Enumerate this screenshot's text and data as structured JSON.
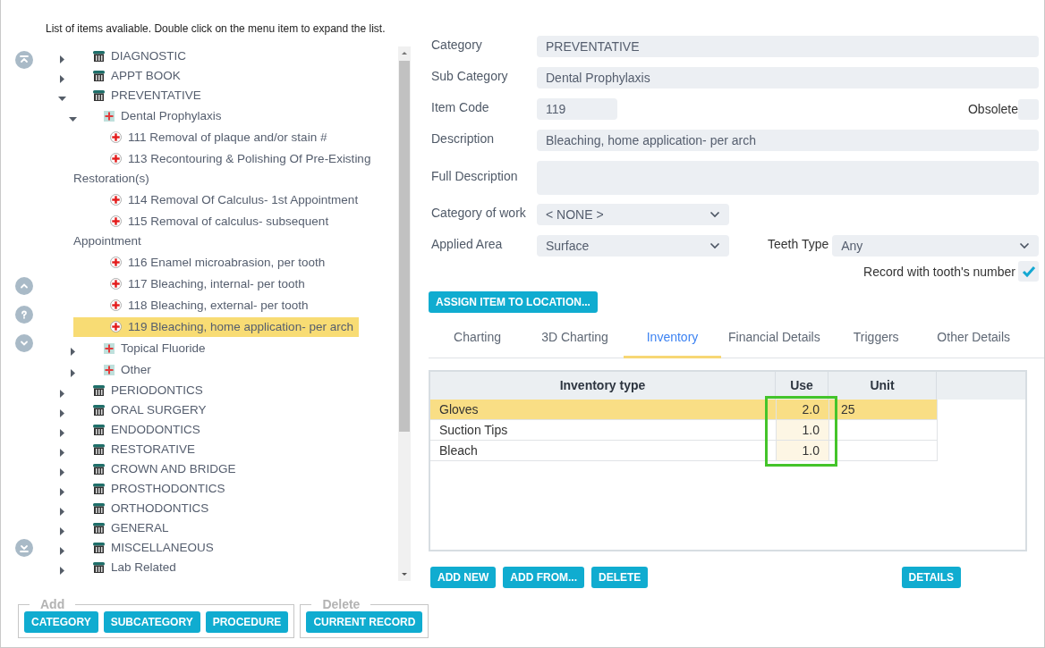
{
  "instructions": "List of items avaliable. Double click on the menu item to expand the list.",
  "tree": [
    {
      "label": "DIAGNOSTIC",
      "kind": "category",
      "expanded": false,
      "selected": false
    },
    {
      "label": "APPT BOOK",
      "kind": "category",
      "expanded": false,
      "selected": false
    },
    {
      "label": "PREVENTATIVE",
      "kind": "category",
      "expanded": true,
      "selected": false,
      "children": [
        {
          "label": "Dental Prophylaxis",
          "kind": "subcategory",
          "expanded": true,
          "selected": false,
          "children": [
            {
              "label": "111 Removal of plaque and/or stain #",
              "kind": "procedure",
              "selected": false
            },
            {
              "label": "113 Recontouring & Polishing Of Pre-Existing Restoration(s)",
              "kind": "procedure",
              "selected": false
            },
            {
              "label": "114 Removal Of Calculus- 1st Appointment",
              "kind": "procedure",
              "selected": false
            },
            {
              "label": "115 Removal of calculus- subsequent Appointment",
              "kind": "procedure",
              "selected": false
            },
            {
              "label": "116 Enamel microabrasion, per tooth",
              "kind": "procedure",
              "selected": false
            },
            {
              "label": "117 Bleaching, internal- per tooth",
              "kind": "procedure",
              "selected": false
            },
            {
              "label": "118 Bleaching, external- per tooth",
              "kind": "procedure",
              "selected": false
            },
            {
              "label": "119 Bleaching, home application- per arch",
              "kind": "procedure",
              "selected": true
            }
          ]
        },
        {
          "label": "Topical Fluoride",
          "kind": "subcategory",
          "expanded": false,
          "selected": false
        },
        {
          "label": "Other",
          "kind": "subcategory",
          "expanded": false,
          "selected": false
        }
      ]
    },
    {
      "label": "PERIODONTICS",
      "kind": "category",
      "expanded": false,
      "selected": false
    },
    {
      "label": "ORAL SURGERY",
      "kind": "category",
      "expanded": false,
      "selected": false
    },
    {
      "label": "ENDODONTICS",
      "kind": "category",
      "expanded": false,
      "selected": false
    },
    {
      "label": "RESTORATIVE",
      "kind": "category",
      "expanded": false,
      "selected": false
    },
    {
      "label": "CROWN AND BRIDGE",
      "kind": "category",
      "expanded": false,
      "selected": false
    },
    {
      "label": "PROSTHODONTICS",
      "kind": "category",
      "expanded": false,
      "selected": false
    },
    {
      "label": "ORTHODONTICS",
      "kind": "category",
      "expanded": false,
      "selected": false
    },
    {
      "label": "GENERAL",
      "kind": "category",
      "expanded": false,
      "selected": false
    },
    {
      "label": "MISCELLANEOUS",
      "kind": "category",
      "expanded": false,
      "selected": false
    },
    {
      "label": "Lab Related",
      "kind": "category",
      "expanded": false,
      "selected": false
    }
  ],
  "add_group": {
    "legend": "Add",
    "buttons": [
      "CATEGORY",
      "SUBCATEGORY",
      "PROCEDURE"
    ]
  },
  "delete_group": {
    "legend": "Delete",
    "buttons": [
      "CURRENT RECORD"
    ]
  },
  "form": {
    "category": {
      "label": "Category",
      "value": "PREVENTATIVE"
    },
    "sub_category": {
      "label": "Sub Category",
      "value": "Dental Prophylaxis"
    },
    "item_code": {
      "label": "Item Code",
      "value": "119"
    },
    "obsolete": {
      "label": "Obsolete",
      "checked": false
    },
    "description": {
      "label": "Description",
      "value": "Bleaching, home application- per arch"
    },
    "full_description": {
      "label": "Full Description"
    },
    "category_of_work": {
      "label": "Category of work",
      "value": "< NONE >"
    },
    "applied_area": {
      "label": "Applied Area",
      "value": "Surface"
    },
    "teeth_type": {
      "label": "Teeth Type",
      "value": "Any"
    },
    "record_with_tooth_number": {
      "label": "Record with tooth's number",
      "checked": true
    }
  },
  "assign_button": "ASSIGN ITEM TO LOCATION...",
  "tabs": [
    {
      "label": "Charting",
      "selected": false
    },
    {
      "label": "3D Charting",
      "selected": false
    },
    {
      "label": "Inventory",
      "selected": true
    },
    {
      "label": "Financial Details",
      "selected": false
    },
    {
      "label": "Triggers",
      "selected": false
    },
    {
      "label": "Other Details",
      "selected": false
    }
  ],
  "inventory_table": {
    "columns": [
      "Inventory type",
      "Use",
      "Unit"
    ],
    "rows": [
      {
        "type": "Gloves",
        "use": "2.0",
        "unit": "25",
        "selected": true
      },
      {
        "type": "Suction Tips",
        "use": "1.0",
        "selected": false
      },
      {
        "type": "Bleach",
        "use": "1.0",
        "selected": false
      }
    ]
  },
  "table_buttons": [
    "ADD NEW",
    "ADD FROM...",
    "DELETE"
  ],
  "details_button": "DETAILS"
}
